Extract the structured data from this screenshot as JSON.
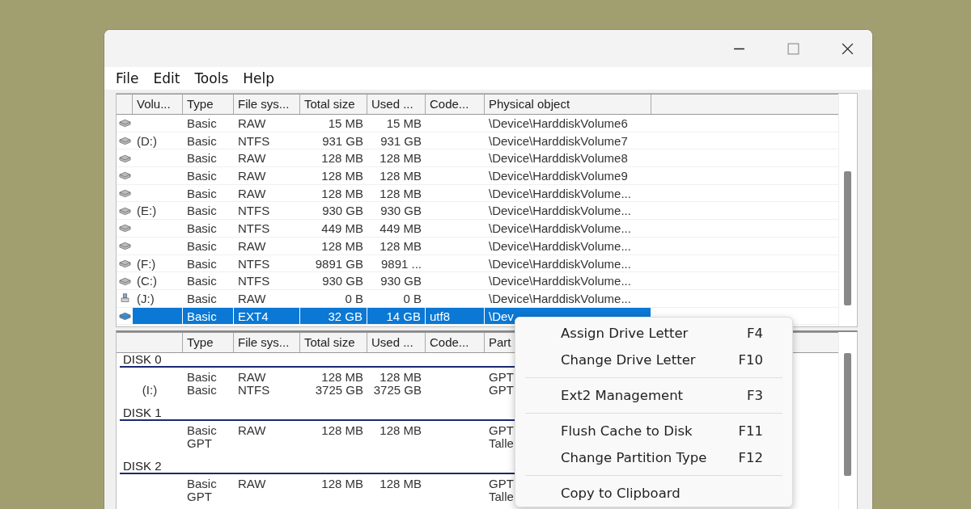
{
  "menu_bar": [
    "File",
    "Edit",
    "Tools",
    "Help"
  ],
  "volume_list": {
    "columns": [
      "Volu...",
      "Type",
      "File sys...",
      "Total size",
      "Used ...",
      "Code...",
      "Physical object"
    ],
    "rows": [
      {
        "kind": "disk",
        "type": "Basic",
        "file_system": "RAW",
        "total_size": "15 MB",
        "used": "15 MB",
        "physical_object": "\\Device\\HarddiskVolume6",
        "selected": false
      },
      {
        "kind": "disk",
        "volume": "(D:)",
        "type": "Basic",
        "file_system": "NTFS",
        "total_size": "931 GB",
        "used": "931 GB",
        "physical_object": "\\Device\\HarddiskVolume7",
        "selected": false
      },
      {
        "kind": "disk",
        "type": "Basic",
        "file_system": "RAW",
        "total_size": "128 MB",
        "used": "128 MB",
        "physical_object": "\\Device\\HarddiskVolume8",
        "selected": false
      },
      {
        "kind": "disk",
        "type": "Basic",
        "file_system": "RAW",
        "total_size": "128 MB",
        "used": "128 MB",
        "physical_object": "\\Device\\HarddiskVolume9",
        "selected": false
      },
      {
        "kind": "disk",
        "type": "Basic",
        "file_system": "RAW",
        "total_size": "128 MB",
        "used": "128 MB",
        "physical_object": "\\Device\\HarddiskVolume...",
        "selected": false
      },
      {
        "kind": "disk",
        "volume": "(E:)",
        "type": "Basic",
        "file_system": "NTFS",
        "total_size": "930 GB",
        "used": "930 GB",
        "physical_object": "\\Device\\HarddiskVolume...",
        "selected": false
      },
      {
        "kind": "disk",
        "type": "Basic",
        "file_system": "NTFS",
        "total_size": "449 MB",
        "used": "449 MB",
        "physical_object": "\\Device\\HarddiskVolume...",
        "selected": false
      },
      {
        "kind": "disk",
        "type": "Basic",
        "file_system": "RAW",
        "total_size": "128 MB",
        "used": "128 MB",
        "physical_object": "\\Device\\HarddiskVolume...",
        "selected": false
      },
      {
        "kind": "disk",
        "volume": "(F:)",
        "type": "Basic",
        "file_system": "NTFS",
        "total_size": "9891 GB",
        "used": "9891 ...",
        "physical_object": "\\Device\\HarddiskVolume...",
        "selected": false
      },
      {
        "kind": "disk",
        "volume": "(C:)",
        "type": "Basic",
        "file_system": "NTFS",
        "total_size": "930 GB",
        "used": "930 GB",
        "physical_object": "\\Device\\HarddiskVolume...",
        "selected": false
      },
      {
        "kind": "usb",
        "volume": "(J:)",
        "type": "Basic",
        "file_system": "RAW",
        "total_size": "0 B",
        "used": "0 B",
        "physical_object": "\\Device\\HarddiskVolume...",
        "selected": false
      },
      {
        "kind": "disk",
        "type": "Basic",
        "file_system": "EXT4",
        "total_size": "32 GB",
        "used": "14 GB",
        "codepage": "utf8",
        "physical_object": "\\Dev",
        "selected": true
      }
    ]
  },
  "disk_list": {
    "columns": [
      "Type",
      "File sys...",
      "Total size",
      "Used ...",
      "Code...",
      "Part"
    ],
    "disks": [
      {
        "label": "DISK 0",
        "rows": [
          {
            "type": "Basic",
            "file_system": "RAW",
            "total_size": "128 MB",
            "used": "128 MB",
            "partition": "GPT"
          },
          {
            "volume": "(I:)",
            "type": "Basic",
            "file_system": "NTFS",
            "total_size": "3725 GB",
            "used": "3725 GB",
            "partition": "GPT"
          }
        ]
      },
      {
        "label": "DISK 1",
        "rows": [
          {
            "type": "Basic",
            "file_system": "RAW",
            "total_size": "128 MB",
            "used": "128 MB",
            "partition": "GPT"
          },
          {
            "type": "GPT",
            "partition": "Talle"
          }
        ]
      },
      {
        "label": "DISK 2",
        "rows": [
          {
            "type": "Basic",
            "file_system": "RAW",
            "total_size": "128 MB",
            "used": "128 MB",
            "partition": "GPT"
          },
          {
            "type": "GPT",
            "partition": "Talle"
          }
        ]
      }
    ]
  },
  "context_menu": {
    "groups": [
      [
        {
          "label": "Assign Drive Letter",
          "shortcut": "F4"
        },
        {
          "label": "Change Drive Letter",
          "shortcut": "F10"
        }
      ],
      [
        {
          "label": "Ext2 Management",
          "shortcut": "F3"
        }
      ],
      [
        {
          "label": "Flush Cache to Disk",
          "shortcut": "F11"
        },
        {
          "label": "Change Partition Type",
          "shortcut": "F12"
        }
      ],
      [
        {
          "label": "Copy to Clipboard"
        }
      ]
    ]
  }
}
